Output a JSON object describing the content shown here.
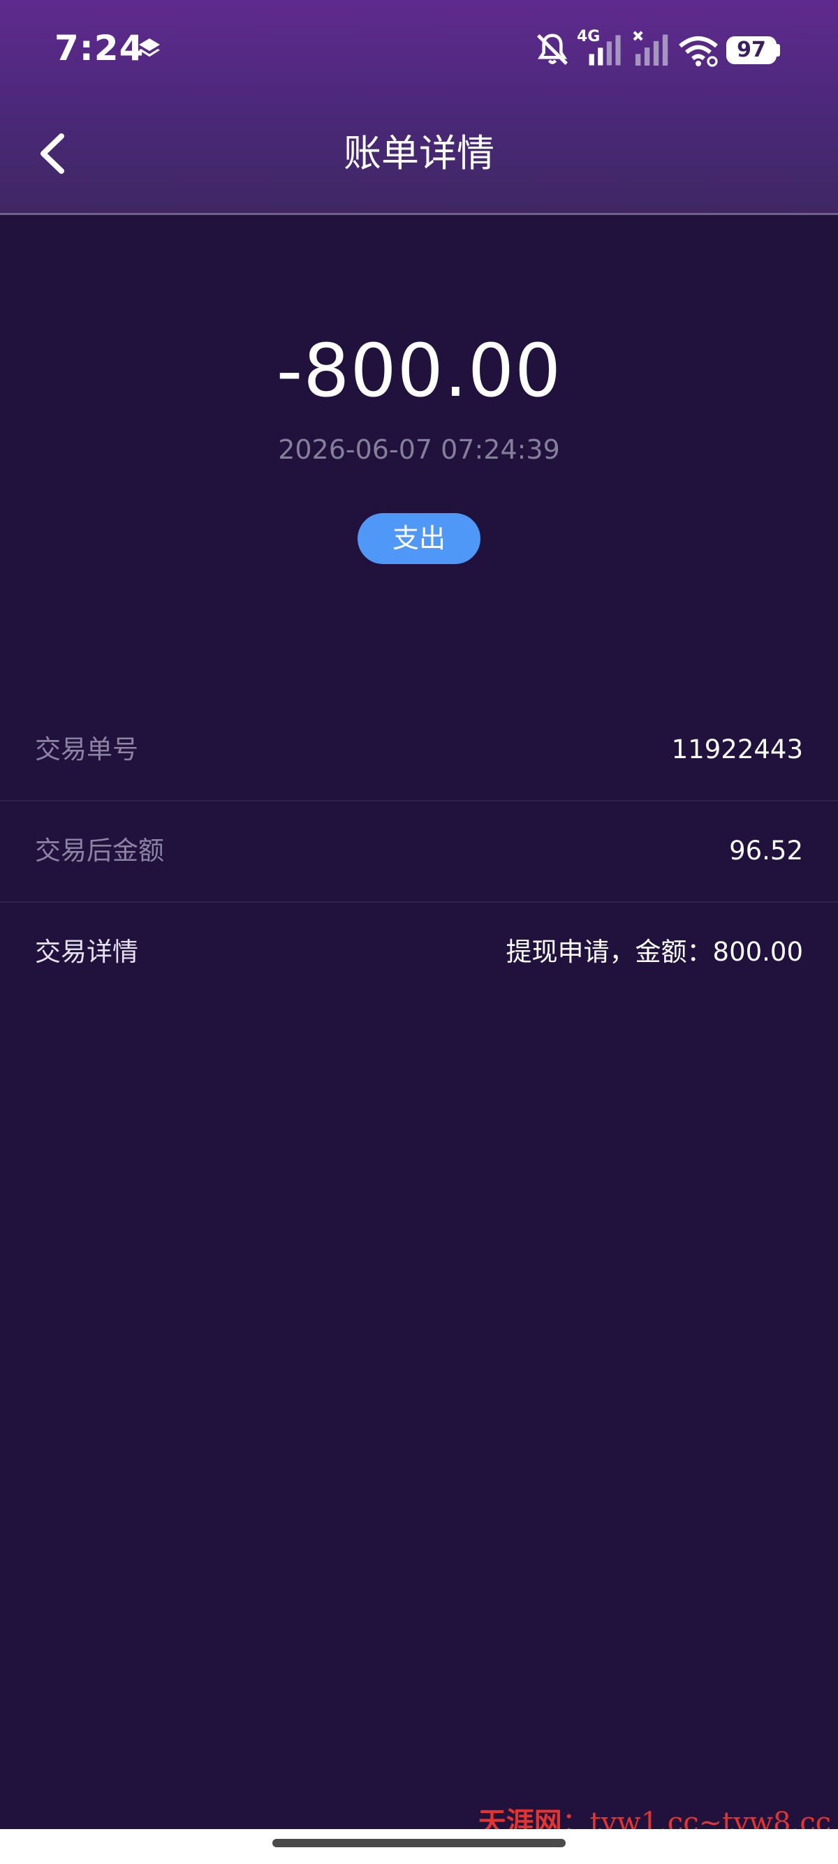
{
  "status_bar": {
    "time": "7:24",
    "network_label": "4G",
    "battery_level": "97",
    "icons": [
      "layers-icon",
      "mute-bell-icon",
      "signal-icon",
      "no-signal-icon",
      "wifi-icon",
      "battery-icon"
    ]
  },
  "header": {
    "title": "账单详情",
    "back_icon": "chevron-left-icon"
  },
  "summary": {
    "amount": "-800.00",
    "datetime": "2026-06-07 07:24:39",
    "type_label": "支出"
  },
  "details": [
    {
      "label": "交易单号",
      "value": "11922443"
    },
    {
      "label": "交易后金额",
      "value": "96.52"
    },
    {
      "label": "交易详情",
      "value": "提现申请，金额：800.00"
    }
  ],
  "watermark": {
    "brand": "天涯网",
    "separator": "：",
    "urls": "tyw1.cc~tyw8.cc"
  },
  "colors": {
    "background": "#20113d",
    "header_top": "#5f2a8e",
    "badge": "#4f98f7",
    "muted_text": "#85809a",
    "watermark": "#e3342f"
  }
}
